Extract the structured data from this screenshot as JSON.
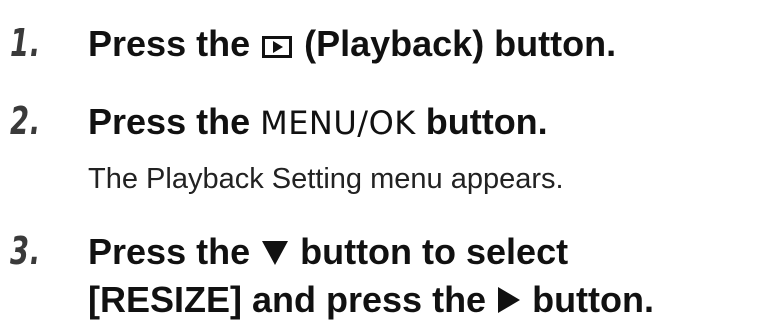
{
  "steps": [
    {
      "number": "1.",
      "parts": {
        "a": "Press the ",
        "icon": "playback-icon",
        "b": " (Playback) button."
      }
    },
    {
      "number": "2.",
      "parts": {
        "a": "Press the ",
        "key": "MENU/OK",
        "b": " button."
      },
      "note": "The Playback Setting menu appears."
    },
    {
      "number": "3.",
      "parts": {
        "a": "Press the ",
        "icon": "down-arrow-icon",
        "b": " button to select",
        "c": "[RESIZE] and press the ",
        "icon2": "right-arrow-icon",
        "d": " button."
      }
    }
  ]
}
